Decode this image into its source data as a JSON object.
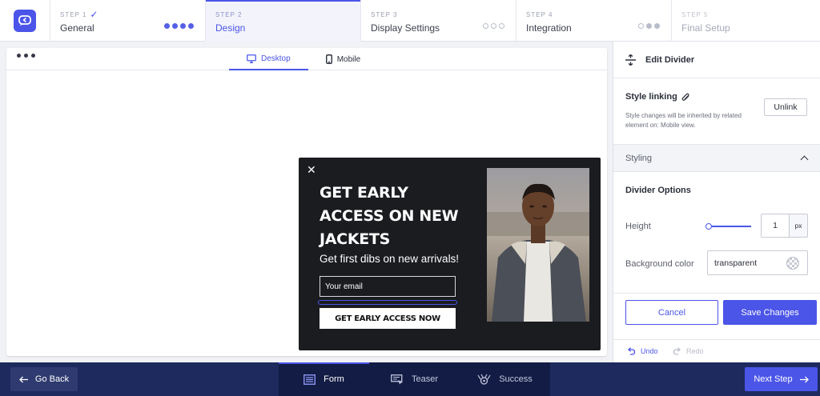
{
  "stepper": {
    "steps": [
      {
        "number": "STEP 1",
        "title": "General",
        "state": "completed"
      },
      {
        "number": "STEP 2",
        "title": "Design",
        "state": "active"
      },
      {
        "number": "STEP 3",
        "title": "Display Settings",
        "state": "pending"
      },
      {
        "number": "STEP 4",
        "title": "Integration",
        "state": "partial"
      },
      {
        "number": "STEP 5",
        "title": "Final Setup",
        "state": "disabled"
      }
    ]
  },
  "canvas": {
    "tabs": [
      {
        "label": "Desktop",
        "icon": "desktop-icon",
        "active": true
      },
      {
        "label": "Mobile",
        "icon": "mobile-icon",
        "active": false
      }
    ],
    "popup": {
      "headline": "GET EARLY ACCESS ON NEW JACKETS",
      "subheadline": "Get first dibs on new arrivals!",
      "email_placeholder": "Your email",
      "cta_label": "GET EARLY ACCESS NOW"
    }
  },
  "editor": {
    "title": "Edit Divider",
    "style_linking": {
      "title": "Style linking",
      "description": "Style changes will be inherited by related element on: Mobile view.",
      "unlink_label": "Unlink"
    },
    "styling_label": "Styling",
    "divider_options": {
      "title": "Divider Options",
      "height_label": "Height",
      "height_value": "1",
      "height_unit": "px",
      "height_slider_fraction": 0.0,
      "bg_label": "Background color",
      "bg_value": "transparent"
    },
    "cancel_label": "Cancel",
    "save_label": "Save Changes",
    "undo_label": "Undo",
    "redo_label": "Redo"
  },
  "footer": {
    "back_label": "Go Back",
    "tabs": [
      {
        "label": "Form",
        "icon": "form-icon",
        "active": true
      },
      {
        "label": "Teaser",
        "icon": "teaser-icon",
        "active": false
      },
      {
        "label": "Success",
        "icon": "trophy-icon",
        "active": false
      }
    ],
    "next_label": "Next Step"
  },
  "colors": {
    "accent": "#4b55e8",
    "footer_bg": "#1e2a5e",
    "popup_bg": "#1b1c20"
  }
}
